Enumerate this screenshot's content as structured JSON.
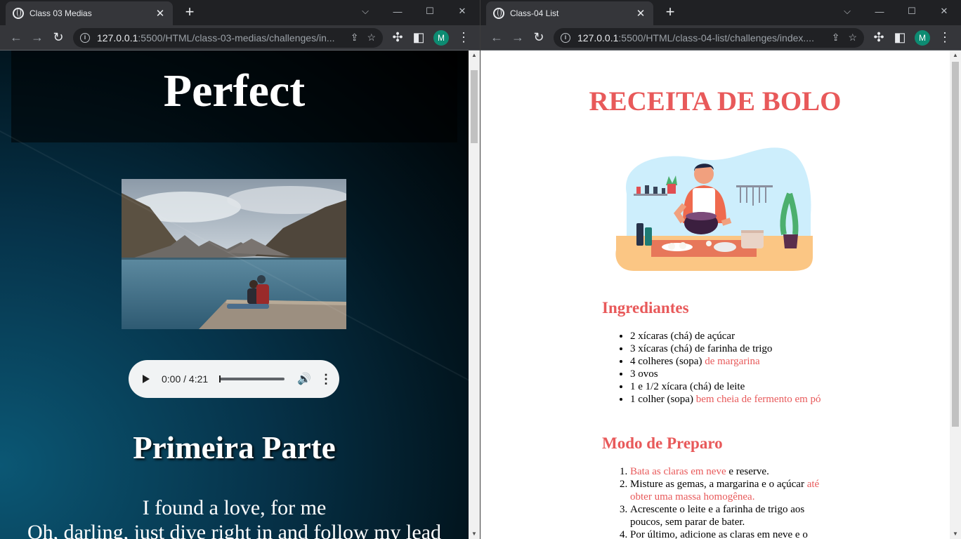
{
  "left_window": {
    "tab_title": "Class 03 Medias",
    "url_host": "127.0.0.1",
    "url_rest": ":5500/HTML/class-03-medias/challenges/in...",
    "avatar_initial": "M",
    "page": {
      "title": "Perfect",
      "audio_time": "0:00 / 4:21",
      "section_heading": "Primeira Parte",
      "lyrics": [
        "I found a love, for me",
        "Oh, darling, just dive right in and follow my lead"
      ]
    }
  },
  "right_window": {
    "tab_title": "Class-04 List",
    "url_host": "127.0.0.1",
    "url_rest": ":5500/HTML/class-04-list/challenges/index....",
    "avatar_initial": "M",
    "page": {
      "title": "RECEITA DE BOLO",
      "ingredients_heading": "Ingrediantes",
      "ingredients": [
        {
          "text": "2 xícaras (chá) de açúcar",
          "highlight": ""
        },
        {
          "text": "3 xícaras (chá) de farinha de trigo",
          "highlight": ""
        },
        {
          "text": "4 colheres (sopa) ",
          "highlight": "de margarina"
        },
        {
          "text": "3 ovos",
          "highlight": ""
        },
        {
          "text": "1 e 1/2 xícara (chá) de leite",
          "highlight": ""
        },
        {
          "text": "1 colher (sopa) ",
          "highlight": "bem cheia de fermento em pó"
        }
      ],
      "preparation_heading": "Modo de Preparo",
      "steps": [
        {
          "highlight": "Bata as claras em neve",
          "text": " e reserve."
        },
        {
          "text": "Misture as gemas, a margarina e o açúcar ",
          "highlight": "até obter uma massa homogênea."
        },
        {
          "text": "Acrescente o leite e a farinha de trigo aos poucos, sem parar de bater.",
          "highlight": ""
        },
        {
          "text": "Por último, adicione as claras em neve e o",
          "highlight": ""
        }
      ]
    }
  },
  "colors": {
    "accent": "#e8595a",
    "browser_frame": "#202124",
    "toolbar": "#35363a",
    "avatar": "#0d8b72"
  }
}
